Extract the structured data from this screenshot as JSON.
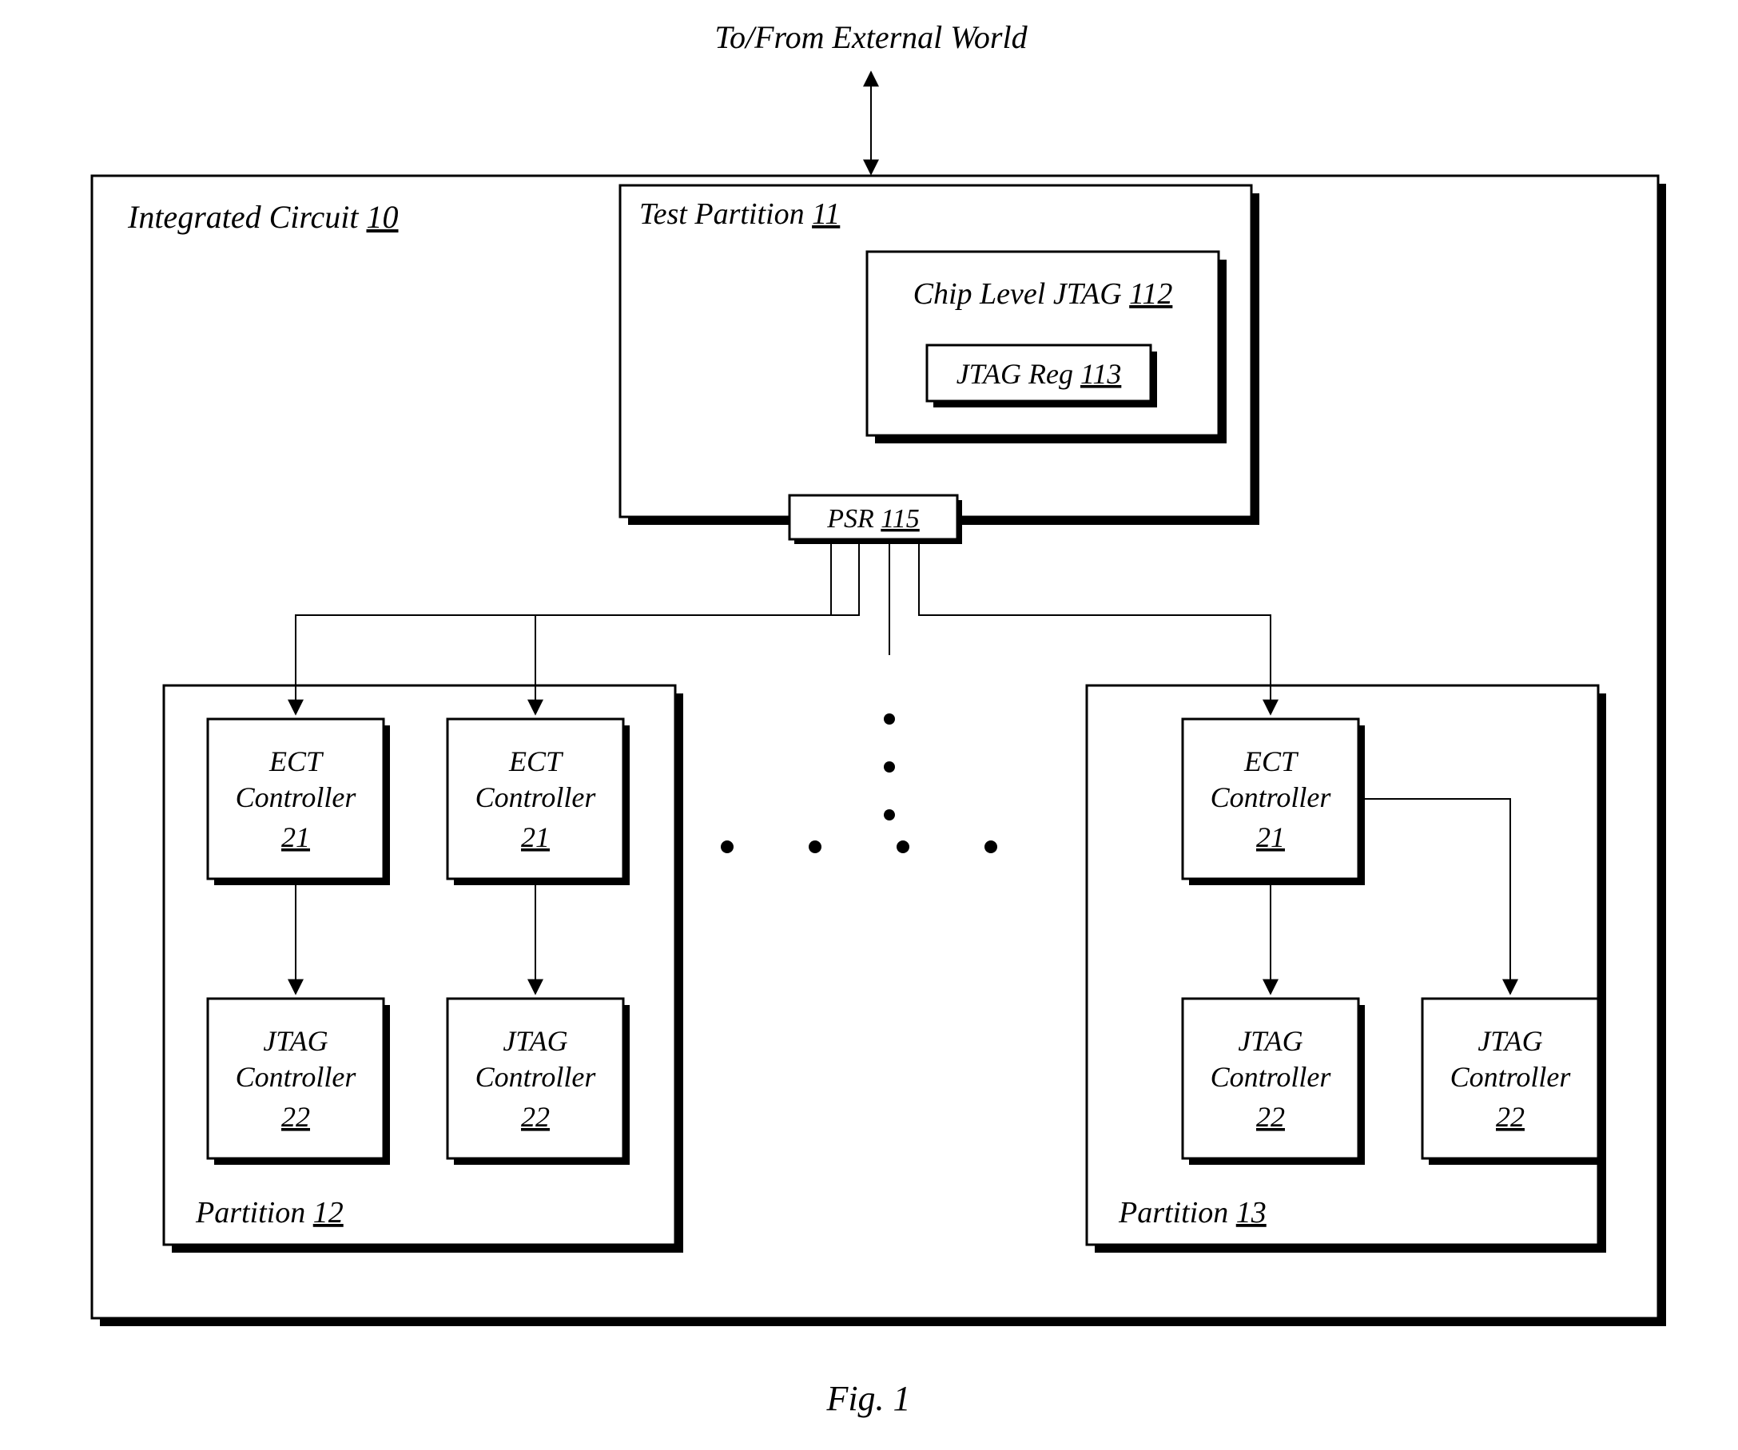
{
  "top_label": "To/From External World",
  "fig_label": "Fig. 1",
  "ic": {
    "label": "Integrated Circuit ",
    "ref": "10"
  },
  "test_partition": {
    "label": "Test Partition ",
    "ref": "11"
  },
  "chip_jtag": {
    "label": "Chip Level JTAG ",
    "ref": "112"
  },
  "jtag_reg": {
    "label": "JTAG Reg ",
    "ref": "113"
  },
  "psr": {
    "label": "PSR ",
    "ref": "115"
  },
  "partition12": {
    "label": "Partition ",
    "ref": "12"
  },
  "partition13": {
    "label": "Partition ",
    "ref": "13"
  },
  "ect": {
    "l1": "ECT",
    "l2": "Controller",
    "ref": "21"
  },
  "jtagc": {
    "l1": "JTAG",
    "l2": "Controller",
    "ref": "22"
  }
}
